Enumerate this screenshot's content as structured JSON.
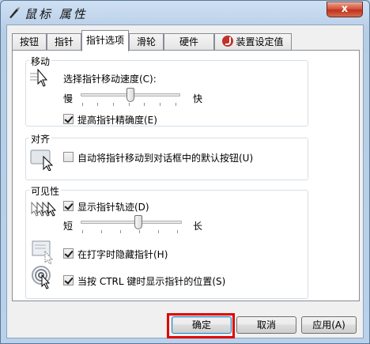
{
  "window": {
    "title": "鼠标 属性",
    "close_label": "x"
  },
  "tabs": [
    {
      "label": "按钮",
      "active": false
    },
    {
      "label": "指针",
      "active": false
    },
    {
      "label": "指针选项",
      "active": true
    },
    {
      "label": "滑轮",
      "active": false
    },
    {
      "label": "硬件",
      "active": false
    },
    {
      "label": "装置设定值",
      "active": false,
      "icon": "synaptics-icon"
    }
  ],
  "motion": {
    "title": "移动",
    "speed_label": "选择指针移动速度(C):",
    "slow_label": "慢",
    "fast_label": "快",
    "speed_value": 0.5,
    "precision_label": "提高指针精确度(E)",
    "precision_checked": true
  },
  "snap": {
    "title": "对齐",
    "snap_label": "自动将指针移动到对话框中的默认按钮(U)",
    "snap_checked": false
  },
  "visibility": {
    "title": "可见性",
    "trails_label": "显示指针轨迹(D)",
    "trails_checked": true,
    "short_label": "短",
    "long_label": "长",
    "trails_value": 0.58,
    "hide_label": "在打字时隐藏指针(H)",
    "hide_checked": true,
    "show_location_label": "当按 CTRL 键时显示指针的位置(S)",
    "show_location_checked": true
  },
  "buttons": {
    "ok": "确定",
    "cancel": "取消",
    "apply": "应用(A)"
  },
  "colors": {
    "highlight": "#e00000",
    "close_red": "#c0311b"
  }
}
